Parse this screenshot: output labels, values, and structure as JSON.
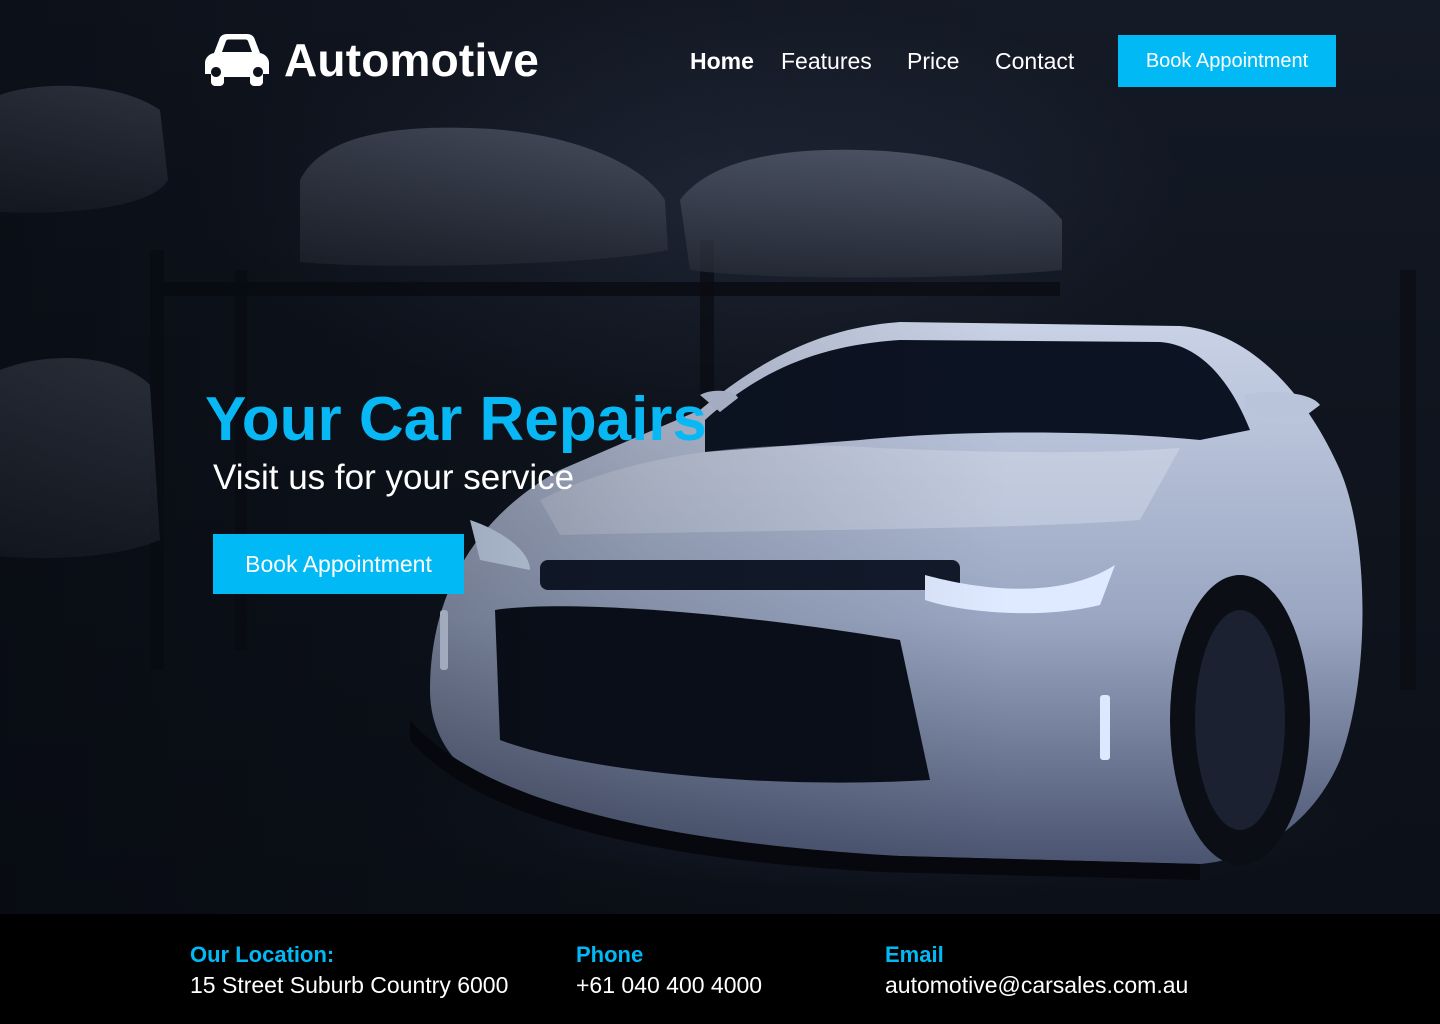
{
  "brand": {
    "name": "Automotive",
    "icon": "car-icon"
  },
  "nav": {
    "items": [
      {
        "label": "Home",
        "active": true
      },
      {
        "label": "Features",
        "active": false
      },
      {
        "label": "Price",
        "active": false
      },
      {
        "label": "Contact",
        "active": false
      }
    ],
    "cta_label": "Book Appointment"
  },
  "hero": {
    "title": "Your Car Repairs",
    "subtitle": "Visit us for your service",
    "cta_label": "Book Appointment",
    "background": "dark garage photo with white sports car"
  },
  "footer": {
    "location": {
      "label": "Our Location:",
      "value": "15 Street Suburb Country 6000"
    },
    "phone": {
      "label": "Phone",
      "value": "+61 040 400 4000"
    },
    "email": {
      "label": "Email",
      "value": "automotive@carsales.com.au"
    }
  },
  "colors": {
    "accent": "#00b9f5",
    "footer_bg": "#000000",
    "text": "#ffffff"
  }
}
